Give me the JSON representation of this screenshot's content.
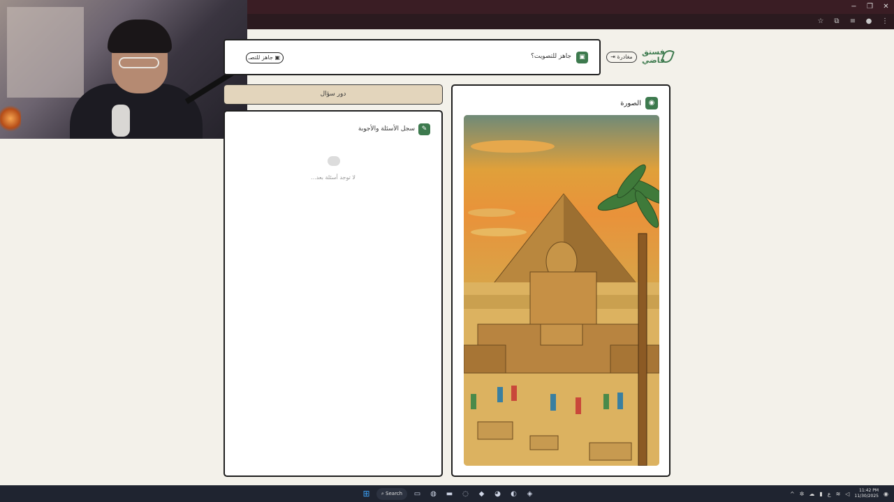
{
  "browser": {
    "window_controls": [
      "−",
      "❐",
      "✕"
    ],
    "toolbar_icons": [
      "star-icon",
      "extensions-icon",
      "media-icon",
      "profile-icon",
      "menu-icon"
    ]
  },
  "app": {
    "logo_text_line1": "فستق",
    "logo_text_line2": "فاضي",
    "logout_label": "مغادرة",
    "ready_label": "جاهز للتصويت؟",
    "guess_label": "جاهز للتصـ",
    "question_turn_label": "دور سؤال",
    "qa_title": "سجل الأسئلة والأجوبة",
    "qa_empty": "لا توجد أسئلة بعد...",
    "image_title": "الصورة",
    "accent_color": "#3d7a4e",
    "turn_bg_color": "#e3d5bc"
  },
  "taskbar": {
    "search_label": "Search",
    "time": "11:42 PM",
    "date": "11/30/2025",
    "lang": "ع"
  }
}
